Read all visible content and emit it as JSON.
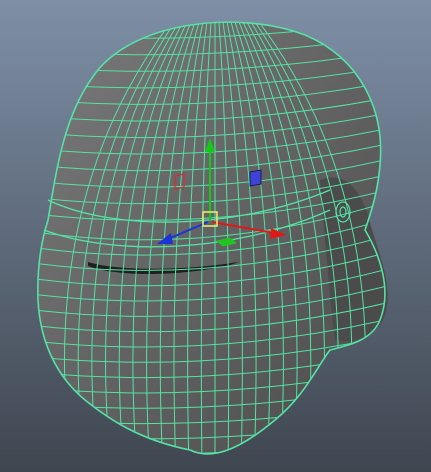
{
  "viewport": {
    "background_top": "#7e8fa6",
    "background_bottom": "#3f4650"
  },
  "model": {
    "name": "helmet-mesh",
    "surface_color": "#7a7a7a",
    "surface_shadow": "#4b4b4b",
    "wireframe_color": "#55e2a6",
    "visor_slit_color": "#202020"
  },
  "manipulator": {
    "x_axis_color": "#e01818",
    "y_axis_color": "#16c916",
    "z_axis_color": "#1a34d8",
    "center_color": "#e8e870",
    "plane_handle_xy_color": "#3e42d6",
    "plane_handle_yz_color": "#c83434",
    "plane_handle_xz_color": "#22c422"
  }
}
